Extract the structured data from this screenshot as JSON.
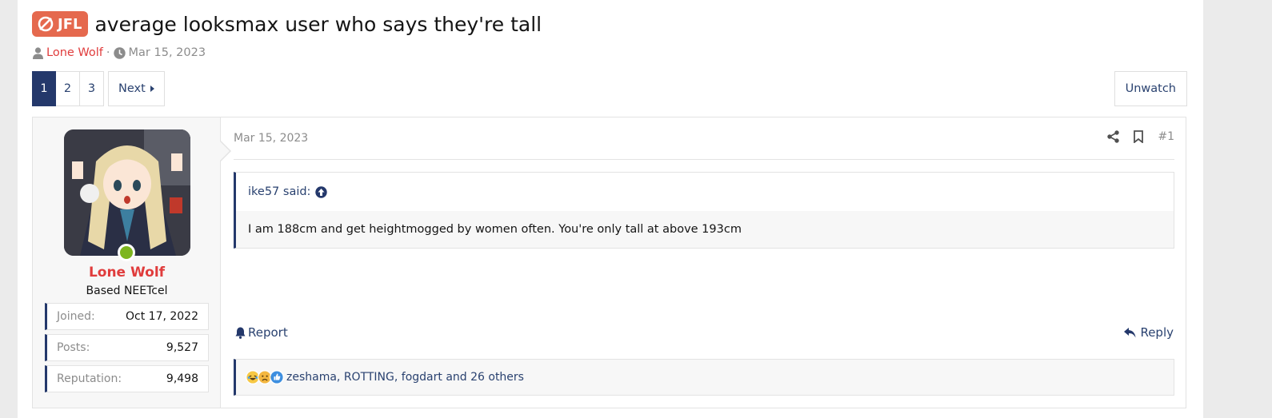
{
  "thread": {
    "prefix": "JFL",
    "title": "average looksmax user who says they're tall",
    "author": "Lone Wolf",
    "separator": "·",
    "date": "Mar 15, 2023"
  },
  "pagination": {
    "pages": [
      "1",
      "2",
      "3"
    ],
    "current": "1",
    "next_label": "Next"
  },
  "unwatch_label": "Unwatch",
  "post": {
    "user": {
      "name": "Lone Wolf",
      "title": "Based NEETcel",
      "online": true,
      "stats": [
        {
          "label": "Joined:",
          "value": "Oct 17, 2022"
        },
        {
          "label": "Posts:",
          "value": "9,527"
        },
        {
          "label": "Reputation:",
          "value": "9,498"
        }
      ]
    },
    "date": "Mar 15, 2023",
    "number": "#1",
    "quote": {
      "author": "ike57 said:",
      "text": "I am 188cm and get heightmogged by women often. You're only tall at above 193cm"
    },
    "report_label": "Report",
    "reply_label": "Reply",
    "reactions": {
      "text": "zeshama, ROTTING, fogdart and 26 others"
    }
  },
  "colors": {
    "accent": "#24386b",
    "link": "#2a4270",
    "username": "#e03c3c",
    "prefix_bg": "#e5694e",
    "online": "#7db51e"
  },
  "icons": [
    "jfl-prefix-icon",
    "user-icon",
    "clock-icon",
    "caret-right-icon",
    "share-icon",
    "bookmark-icon",
    "arrow-up-circle-icon",
    "bell-icon",
    "reply-icon",
    "reaction-laugh-icon",
    "reaction-sad-icon",
    "reaction-like-icon"
  ]
}
